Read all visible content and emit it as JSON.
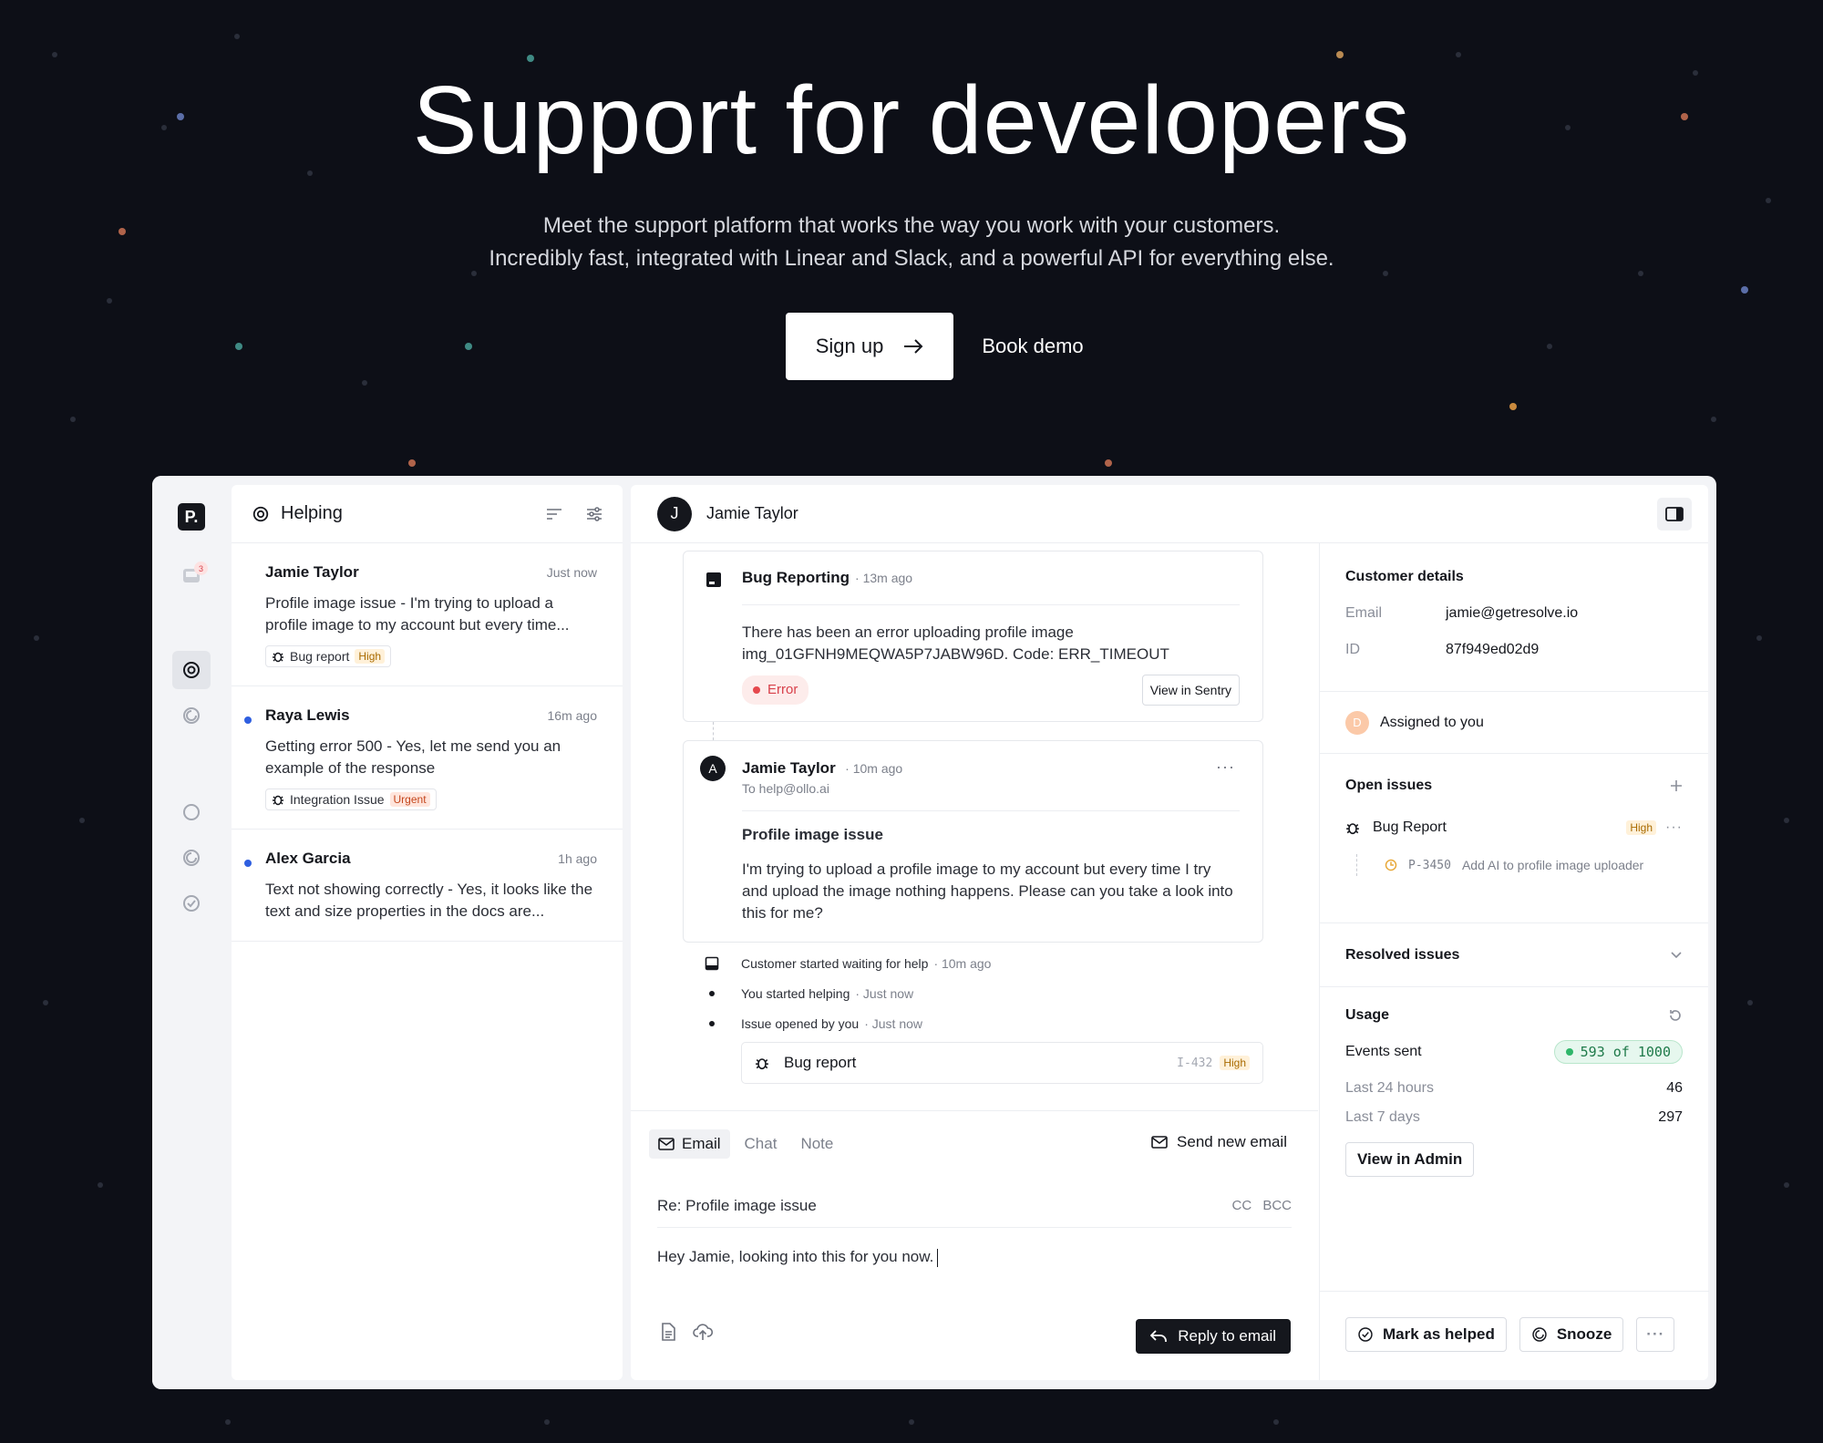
{
  "hero": {
    "title": "Support for developers",
    "subtitle_line1": "Meet the support platform that works the way you work with your customers.",
    "subtitle_line2": "Incredibly fast, integrated with Linear and Slack, and a powerful API for everything else.",
    "signup_label": "Sign up",
    "signup_icon": "arrow-right-icon",
    "demo_label": "Book demo"
  },
  "rail": {
    "logo": "P.",
    "inbox_badge": "3"
  },
  "list": {
    "title": "Helping",
    "conversations": [
      {
        "name": "Jamie Taylor",
        "time": "Just now",
        "preview": "Profile image issue - I'm trying to upload a profile image to my account but every time...",
        "tag": "Bug report",
        "priority": "High",
        "unread": false
      },
      {
        "name": "Raya Lewis",
        "time": "16m ago",
        "preview": "Getting error 500 - Yes, let me send you an example of the response",
        "tag": "Integration Issue",
        "priority": "Urgent",
        "unread": true
      },
      {
        "name": "Alex Garcia",
        "time": "1h ago",
        "preview": "Text not showing correctly - Yes, it looks like the text and size properties in the docs are...",
        "tag": "",
        "priority": "",
        "unread": true
      }
    ]
  },
  "main": {
    "contact_initial": "J",
    "contact_name": "Jamie Taylor",
    "bug": {
      "title": "Bug Reporting",
      "time": "· 13m ago",
      "line1": "There has been an error uploading profile image",
      "line2": "img_01GFNH9MEQWA5P7JABW96D. Code: ERR_TIMEOUT",
      "status": "Error",
      "action": "View in Sentry"
    },
    "email": {
      "avatar": "A",
      "from": "Jamie Taylor",
      "time": "· 10m ago",
      "to": "To help@ollo.ai",
      "subject": "Profile image issue",
      "body": "I'm trying to upload a profile image to my account but every time I try and upload the image nothing happens. Please can you take a look into this for me?"
    },
    "events": [
      {
        "text": "Customer started waiting for help",
        "time": "· 10m ago"
      },
      {
        "text": "You started helping",
        "time": "· Just now"
      },
      {
        "text": "Issue opened by you",
        "time": "· Just now"
      }
    ],
    "issue_card": {
      "label": "Bug report",
      "id": "I-432",
      "priority": "High"
    },
    "compose": {
      "tab_email": "Email",
      "tab_chat": "Chat",
      "tab_note": "Note",
      "send_new": "Send new email",
      "subject": "Re: Profile image issue",
      "cc": "CC",
      "bcc": "BCC",
      "message": "Hey Jamie, looking into this for you now.",
      "reply": "Reply to email"
    }
  },
  "side": {
    "customer_title": "Customer details",
    "email_label": "Email",
    "email_value": "jamie@getresolve.io",
    "id_label": "ID",
    "id_value": "87f949ed02d9",
    "assignee_initial": "D",
    "assigned": "Assigned to you",
    "open_issues": "Open issues",
    "issue_label": "Bug Report",
    "issue_priority": "High",
    "linear_id": "P-3450",
    "linear_title": "Add AI to profile image uploader",
    "resolved_issues": "Resolved issues",
    "usage_title": "Usage",
    "events_label": "Events sent",
    "events_value": "593 of 1000",
    "last24_label": "Last 24 hours",
    "last24_value": "46",
    "last7_label": "Last 7 days",
    "last7_value": "297",
    "admin_btn": "View in Admin",
    "mark_helped": "Mark as helped",
    "snooze": "Snooze"
  }
}
